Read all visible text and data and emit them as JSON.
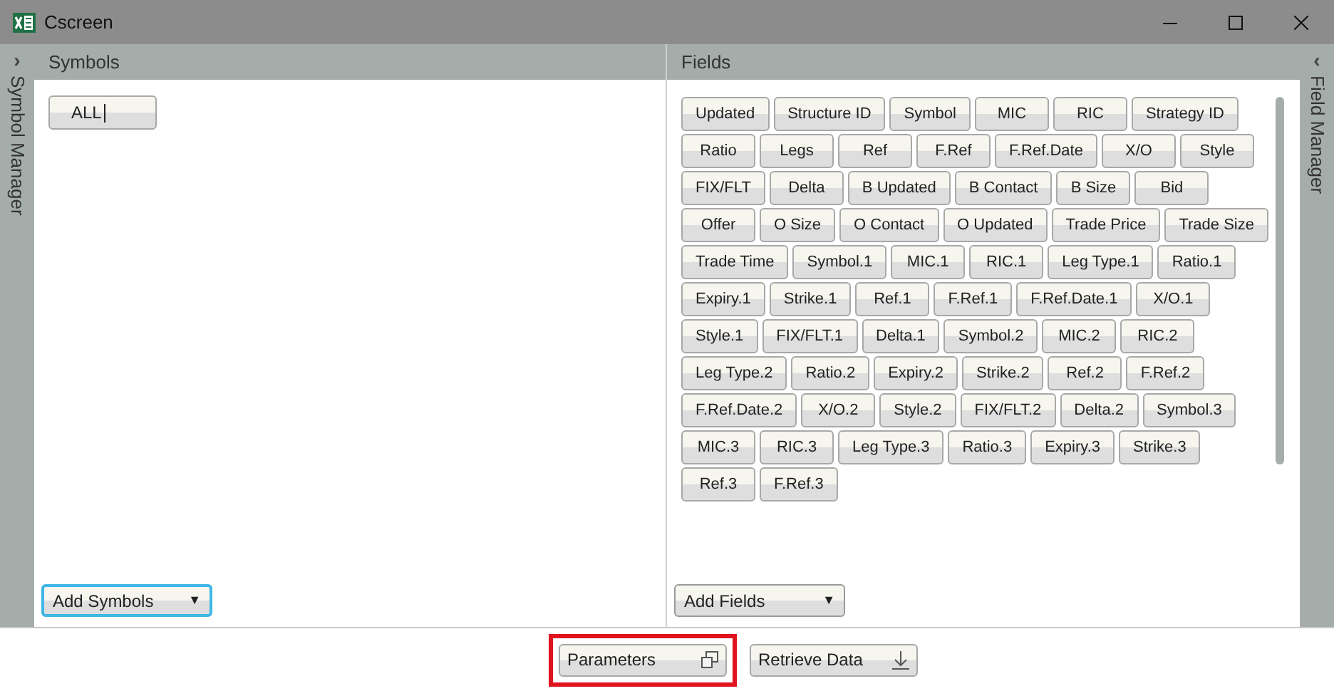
{
  "window": {
    "title": "Cscreen"
  },
  "left_sidebar": {
    "label": "Symbol Manager",
    "toggle": "›"
  },
  "symbols": {
    "title": "Symbols",
    "items": [
      "ALL"
    ],
    "add_button": "Add Symbols",
    "caret": "▼",
    "focused": true
  },
  "fields": {
    "title": "Fields",
    "items": [
      "Updated",
      "Structure ID",
      "Symbol",
      "MIC",
      "RIC",
      "Strategy ID",
      "Ratio",
      "Legs",
      "Ref",
      "F.Ref",
      "F.Ref.Date",
      "X/O",
      "Style",
      "FIX/FLT",
      "Delta",
      "B Updated",
      "B Contact",
      "B Size",
      "Bid",
      "Offer",
      "O Size",
      "O Contact",
      "O Updated",
      "Trade Price",
      "Trade Size",
      "Trade Time",
      "Symbol.1",
      "MIC.1",
      "RIC.1",
      "Leg Type.1",
      "Ratio.1",
      "Expiry.1",
      "Strike.1",
      "Ref.1",
      "F.Ref.1",
      "F.Ref.Date.1",
      "X/O.1",
      "Style.1",
      "FIX/FLT.1",
      "Delta.1",
      "Symbol.2",
      "MIC.2",
      "RIC.2",
      "Leg Type.2",
      "Ratio.2",
      "Expiry.2",
      "Strike.2",
      "Ref.2",
      "F.Ref.2",
      "F.Ref.Date.2",
      "X/O.2",
      "Style.2",
      "FIX/FLT.2",
      "Delta.2",
      "Symbol.3",
      "MIC.3",
      "RIC.3",
      "Leg Type.3",
      "Ratio.3",
      "Expiry.3",
      "Strike.3",
      "Ref.3",
      "F.Ref.3"
    ],
    "add_button": "Add Fields",
    "caret": "▼"
  },
  "right_sidebar": {
    "label": "Field Manager",
    "toggle": "‹"
  },
  "footer": {
    "buttons": [
      {
        "label": "Parameters",
        "kind": "windows",
        "highlighted": true
      },
      {
        "label": "Retrieve Data",
        "kind": "download",
        "highlighted": false
      }
    ]
  }
}
